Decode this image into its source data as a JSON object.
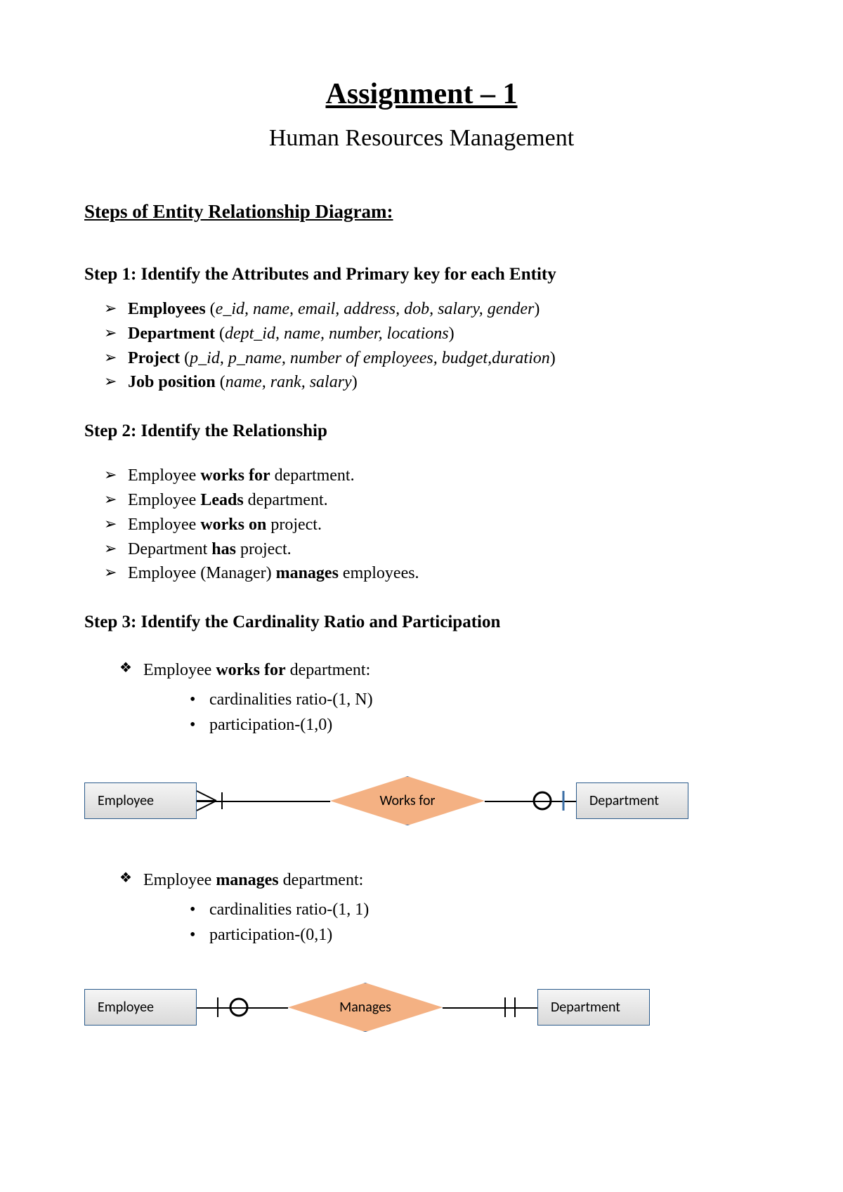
{
  "title": "Assignment – 1",
  "subtitle": "Human Resources Management",
  "section_heading": " Steps of Entity Relationship Diagram:",
  "step1": {
    "heading": "Step 1: Identify the Attributes and Primary key for each Entity",
    "items": [
      {
        "entity": "Employees",
        "attrs": "e_id, name, email, address, dob,  salary, gender"
      },
      {
        "entity": "Department",
        "attrs": "dept_id, name, number, locations"
      },
      {
        "entity": "Project",
        "attrs": "p_id, p_name, number of employees, budget,duration"
      },
      {
        "entity": "Job position",
        "attrs": "name, rank, salary"
      }
    ]
  },
  "step2": {
    "heading": "Step 2: Identify the Relationship",
    "items": [
      {
        "pre": "Employee ",
        "rel": "works for",
        "post": " department."
      },
      {
        "pre": "Employee ",
        "rel": "Leads",
        "post": " department."
      },
      {
        "pre": "Employee ",
        "rel": "works on",
        "post": " project."
      },
      {
        "pre": "Department ",
        "rel": "has",
        "post": " project."
      },
      {
        "pre": "Employee (Manager) ",
        "rel": "manages",
        "post": " employees."
      }
    ]
  },
  "step3": {
    "heading": "Step 3: Identify the Cardinality Ratio and Participation",
    "cases": [
      {
        "line_pre": "Employee ",
        "line_rel": "works for",
        "line_post": " department:",
        "bullets": [
          "cardinalities ratio-(1, N)",
          "participation-(1,0)"
        ],
        "diagram": {
          "left_entity": "Employee",
          "relationship": "Works for",
          "right_entity": "Department",
          "left_notation": "crowfoot-one",
          "right_notation": "circle-one"
        }
      },
      {
        "line_pre": "Employee ",
        "line_rel": "manages",
        "line_post": " department:",
        "bullets": [
          "cardinalities ratio-(1, 1)",
          "participation-(0,1)"
        ],
        "diagram": {
          "left_entity": "Employee",
          "relationship": "Manages",
          "right_entity": "Department",
          "left_notation": "one-circle",
          "right_notation": "one-one"
        }
      }
    ]
  }
}
